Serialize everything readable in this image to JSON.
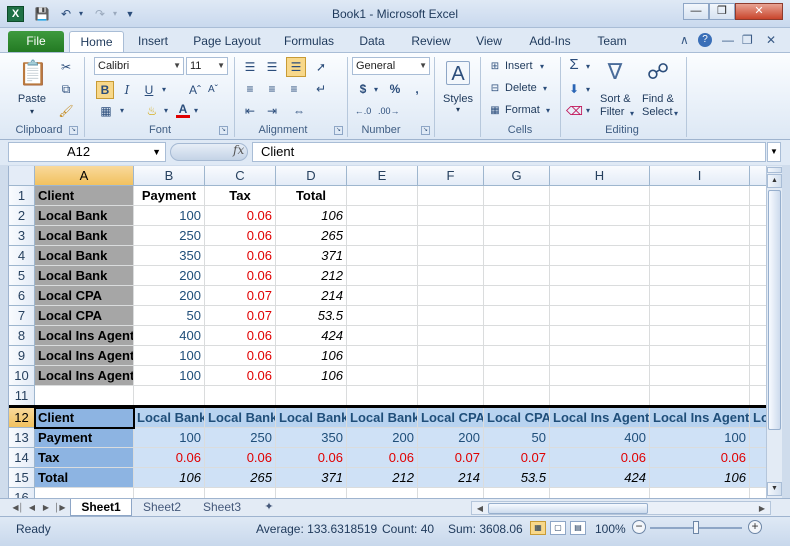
{
  "window": {
    "title": "Book1  -  Microsoft Excel",
    "minimize_icon": "minimize-icon",
    "maximize_icon": "restore-icon",
    "close_icon": "close-icon"
  },
  "ribbon_tabs": [
    "File",
    "Home",
    "Insert",
    "Page Layout",
    "Formulas",
    "Data",
    "Review",
    "View",
    "Add-Ins",
    "Team"
  ],
  "ribbon": {
    "clipboard": {
      "label": "Clipboard",
      "paste": "Paste"
    },
    "font": {
      "label": "Font",
      "name": "Calibri",
      "size": "11",
      "bold": "B",
      "italic": "I",
      "underline": "U"
    },
    "alignment": {
      "label": "Alignment"
    },
    "number": {
      "label": "Number",
      "format": "General",
      "currency": "$",
      "percent": "%",
      "comma": ","
    },
    "styles": {
      "label": "Styles"
    },
    "cells": {
      "label": "Cells",
      "insert": "Insert",
      "delete": "Delete",
      "format": "Format"
    },
    "editing": {
      "label": "Editing",
      "sort_filter_1": "Sort &",
      "sort_filter_2": "Filter",
      "find_select_1": "Find &",
      "find_select_2": "Select"
    }
  },
  "formula_bar": {
    "name_box": "A12",
    "fx": "fx",
    "content": "Client"
  },
  "columns": [
    "A",
    "B",
    "C",
    "D",
    "E",
    "F",
    "G",
    "H",
    "I"
  ],
  "selected_column": "A",
  "rows": [
    "1",
    "2",
    "3",
    "4",
    "5",
    "6",
    "7",
    "8",
    "9",
    "10",
    "11",
    "12",
    "13",
    "14",
    "15",
    "16"
  ],
  "table1": {
    "headers": [
      "Client",
      "Payment",
      "Tax",
      "Total"
    ],
    "rows": [
      [
        "Local Bank",
        "100",
        "0.06",
        "106"
      ],
      [
        "Local Bank",
        "250",
        "0.06",
        "265"
      ],
      [
        "Local Bank",
        "350",
        "0.06",
        "371"
      ],
      [
        "Local Bank",
        "200",
        "0.06",
        "212"
      ],
      [
        "Local CPA",
        "200",
        "0.07",
        "214"
      ],
      [
        "Local CPA",
        "50",
        "0.07",
        "53.5"
      ],
      [
        "Local Ins Agent",
        "400",
        "0.06",
        "424"
      ],
      [
        "Local Ins Agent",
        "100",
        "0.06",
        "106"
      ],
      [
        "Local Ins Agent",
        "100",
        "0.06",
        "106"
      ]
    ]
  },
  "table2": {
    "row_labels": [
      "Client",
      "Payment",
      "Tax",
      "Total"
    ],
    "clients": [
      "Local Bank",
      "Local Bank",
      "Local Bank",
      "Local Bank",
      "Local CPA",
      "Local CPA",
      "Local Ins Agent",
      "Local Ins Agent",
      "Lo"
    ],
    "payments": [
      "100",
      "250",
      "350",
      "200",
      "200",
      "50",
      "400",
      "100"
    ],
    "taxes": [
      "0.06",
      "0.06",
      "0.06",
      "0.06",
      "0.07",
      "0.07",
      "0.06",
      "0.06"
    ],
    "totals": [
      "106",
      "265",
      "371",
      "212",
      "214",
      "53.5",
      "424",
      "106"
    ]
  },
  "sheets": [
    "Sheet1",
    "Sheet2",
    "Sheet3"
  ],
  "active_sheet": "Sheet1",
  "status": {
    "mode": "Ready",
    "average": "Average: 133.6318519",
    "count": "Count: 40",
    "sum": "Sum: 3608.06",
    "zoom": "100%"
  },
  "colors": {
    "tax_red": "#e00000",
    "payment_blue": "#1f4e79",
    "highlight_blue": "#b8d3f0",
    "file_tab_green": "#2f8a2f"
  }
}
